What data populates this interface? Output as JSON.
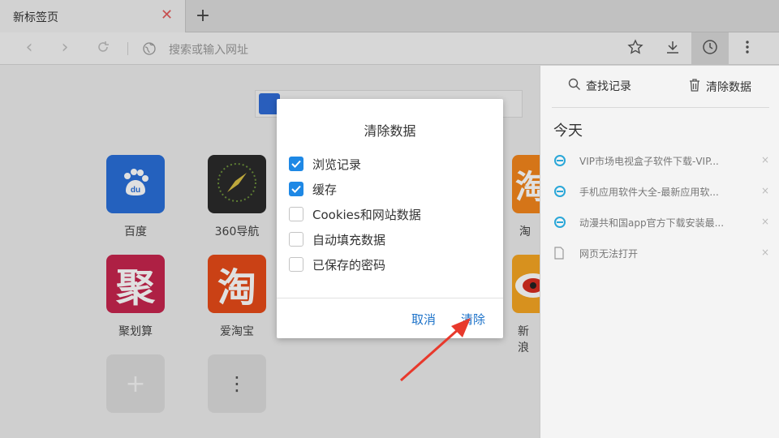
{
  "tab": {
    "title": "新标签页",
    "close_glyph": "✕",
    "new_tab_glyph": "+"
  },
  "toolbar": {
    "back_glyph": "‹",
    "forward_glyph": "›",
    "address_placeholder": "搜索或输入网址"
  },
  "speed_dial": {
    "tiles": [
      {
        "label": "百度",
        "icon": "baidu-icon",
        "color": "#2a6fd9"
      },
      {
        "label": "360导航",
        "icon": "compass-icon",
        "color": "#2b2b2b"
      },
      {
        "label": "淘",
        "icon": "taobao-partial-icon",
        "color": "#f3861c"
      },
      {
        "label": "聚划算",
        "icon": "juhuasuan-icon",
        "color": "#c7254e",
        "glyph": "聚"
      },
      {
        "label": "爱淘宝",
        "icon": "aitaobao-icon",
        "color": "#e64a19",
        "glyph": "淘"
      },
      {
        "label": "新浪",
        "icon": "weibo-icon",
        "color": "#f5a623"
      }
    ],
    "partial_tile_glyph": "淘",
    "add_glyph": "+",
    "more_glyph": "⋮"
  },
  "history_panel": {
    "search_label": "查找记录",
    "clear_label": "清除数据",
    "section_today": "今天",
    "items": [
      {
        "title": "VIP市场电视盒子软件下载-VIP...",
        "icon": "ie-icon"
      },
      {
        "title": "手机应用软件大全-最新应用软...",
        "icon": "ie-icon"
      },
      {
        "title": "动漫共和国app官方下载安装最...",
        "icon": "ie-icon"
      },
      {
        "title": "网页无法打开",
        "icon": "page-icon"
      }
    ],
    "remove_glyph": "×"
  },
  "dialog": {
    "title": "清除数据",
    "options": [
      {
        "label": "浏览记录",
        "checked": true
      },
      {
        "label": "缓存",
        "checked": true
      },
      {
        "label": "Cookies和网站数据",
        "checked": false
      },
      {
        "label": "自动填充数据",
        "checked": false
      },
      {
        "label": "已保存的密码",
        "checked": false
      }
    ],
    "cancel_label": "取消",
    "confirm_label": "清除"
  },
  "colors": {
    "accent": "#1e88e5",
    "link": "#1e73c9",
    "annotation": "#e8392c"
  }
}
